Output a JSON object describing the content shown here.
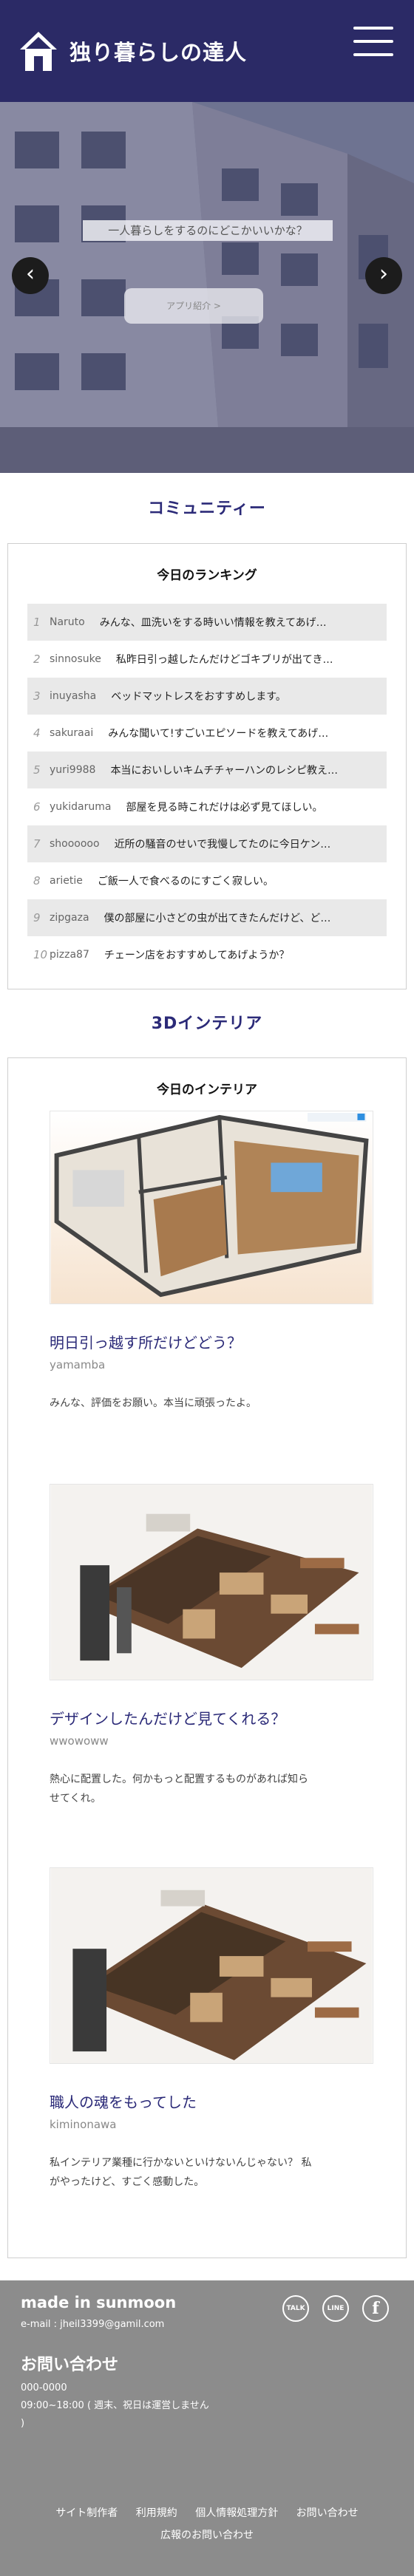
{
  "header": {
    "title": "独り暮らしの達人"
  },
  "hero": {
    "caption": "一人暮らしをするのにどこかいいかな？",
    "button": "アプリ紹介 >",
    "prev": "‹",
    "next": "›"
  },
  "community": {
    "title": "コミュニティー",
    "ranking_title": "今日のランキング",
    "rankings": [
      {
        "rank": "1",
        "user": "Naruto",
        "text": "みんな、皿洗いをする時いい情報を教えてあげ…"
      },
      {
        "rank": "2",
        "user": "sinnosuke",
        "text": "私昨日引っ越したんだけどゴキブリが出てき…"
      },
      {
        "rank": "3",
        "user": "inuyasha",
        "text": "ベッドマットレスをおすすめします。"
      },
      {
        "rank": "4",
        "user": "sakuraai",
        "text": "みんな聞いて!すごいエピソードを教えてあげ…"
      },
      {
        "rank": "5",
        "user": "yuri9988",
        "text": "本当においしいキムチチャーハンのレシピ教え…"
      },
      {
        "rank": "6",
        "user": "yukidaruma",
        "text": "部屋を見る時これだけは必ず見てほしい。"
      },
      {
        "rank": "7",
        "user": "shoooooo",
        "text": "近所の騒音のせいで我慢してたのに今日ケン…"
      },
      {
        "rank": "8",
        "user": "arietie",
        "text": "ご飯一人で食べるのにすごく寂しい。"
      },
      {
        "rank": "9",
        "user": "zipgaza",
        "text": "僕の部屋に小さどの虫が出てきたんだけど、ど…"
      },
      {
        "rank": "10",
        "user": "pizza87",
        "text": "チェーン店をおすすめしてあげようか？"
      }
    ]
  },
  "interior": {
    "title": "3Dインテリア",
    "heading": "今日のインテリア",
    "entries": [
      {
        "title": "明日引っ越す所だけどどう？",
        "author": "yamamba",
        "body": "みんな、評価をお願い。本当に頑張ったよ。"
      },
      {
        "title": "デザインしたんだけど見てくれる？",
        "author": "wwowoww",
        "body": "熱心に配置した。何かもっと配置するものがあれば知らせてくれ。"
      },
      {
        "title": "職人の魂をもってした",
        "author": "kiminonawa",
        "body": "私インテリア業種に行かないといけないんじゃない？ 私がやったけど、すごく感動した。"
      }
    ]
  },
  "footer": {
    "brand": "made in sunmoon",
    "email": "e-mail : jheil3399@gamil.com",
    "contact_title": "お問い合わせ",
    "phone": "000-0000",
    "hours": "09:00~18:00 ( 週末、祝日は運営しません )",
    "social": [
      "TALK",
      "LINE",
      "f"
    ],
    "links": [
      "サイト制作者",
      "利用規約",
      "個人情報処理方針",
      "お問い合わせ",
      "広報のお問い合わせ"
    ]
  },
  "colors": {
    "header": "#2b2a66",
    "accent": "#2b2a78",
    "footer": "#8c8c8c"
  },
  "icons": {
    "logo": "house-icon",
    "menu": "hamburger-menu-icon"
  }
}
